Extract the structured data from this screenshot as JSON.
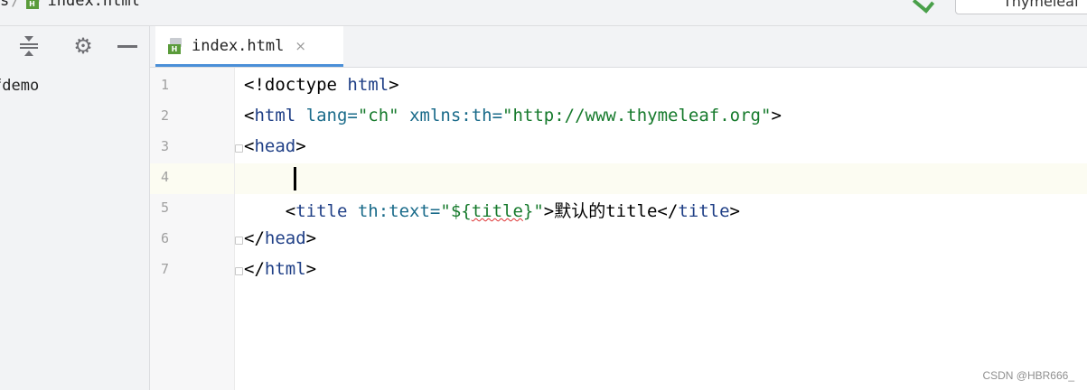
{
  "breadcrumb": {
    "prev_sep": "s",
    "sep": "/",
    "file_badge": "H",
    "file_name": "index.html"
  },
  "top_right": {
    "config_label": "Thymeleaf"
  },
  "project_panel": {
    "tree_item": "fdemo"
  },
  "tab": {
    "badge": "H",
    "title": "index.html",
    "close": "×"
  },
  "editor": {
    "line_numbers": [
      "1",
      "2",
      "3",
      "4",
      "5",
      "6",
      "7"
    ],
    "lines": [
      {
        "p1": "<!doctype ",
        "p2": "html",
        "p3": ">"
      },
      {
        "p1": "<",
        "p2": "html",
        "p3": " lang=",
        "p4": "\"ch\"",
        "p5": " xmlns:th=",
        "p6": "\"http://www.thymeleaf.org\"",
        "p7": ">"
      },
      {
        "p1": "<",
        "p2": "head",
        "p3": ">"
      },
      {},
      {
        "indent": "    ",
        "p1": "<",
        "p2": "title",
        "p3": " th:text=",
        "p4": "\"${",
        "p5": "title",
        "p6": "}\"",
        "p7": ">默认的title</",
        "p8": "title",
        "p9": ">"
      },
      {
        "p1": "</",
        "p2": "head",
        "p3": ">"
      },
      {
        "p1": "</",
        "p2": "html",
        "p3": ">"
      }
    ]
  },
  "watermark": "CSDN @HBR666_",
  "colors": {
    "accent": "#4a8fd8",
    "tag": "#1f3f86",
    "string": "#167a2c",
    "attr": "#1a6b8a"
  }
}
